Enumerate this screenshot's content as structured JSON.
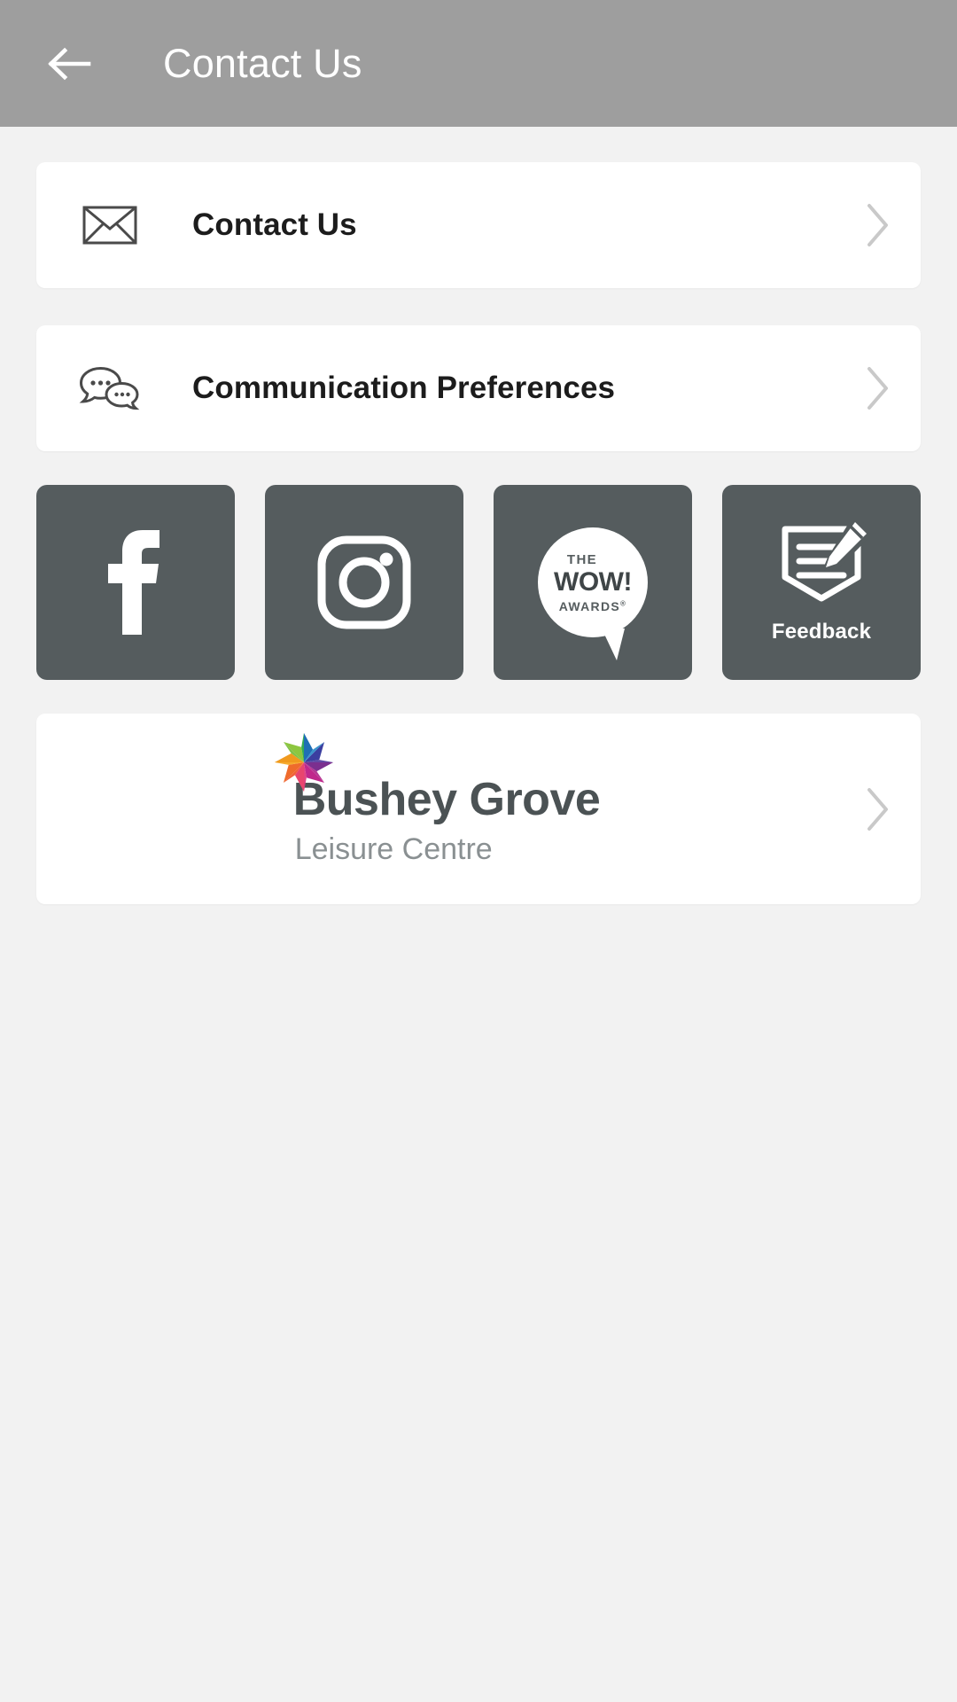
{
  "appbar": {
    "back_icon": "back-arrow-icon",
    "title": "Contact Us",
    "background_color": "#9e9e9e",
    "title_color": "#ffffff"
  },
  "colors": {
    "page_background": "#f2f2f2",
    "card_background": "#ffffff",
    "tile_background": "#555c5e",
    "chevron": "#c9c9c9",
    "primary_text": "#1c1c1c",
    "logo_name": "#4b5254",
    "logo_sub": "#8a9092"
  },
  "rows": [
    {
      "icon": "envelope-icon",
      "label": "Contact Us",
      "chevron": "chevron-right-icon"
    },
    {
      "icon": "chat-bubbles-icon",
      "label": "Communication Preferences",
      "chevron": "chevron-right-icon"
    }
  ],
  "tiles": [
    {
      "icon": "facebook-icon",
      "label": ""
    },
    {
      "icon": "instagram-icon",
      "label": ""
    },
    {
      "icon": "wow-awards-icon",
      "label": "",
      "wow_the": "THE",
      "wow_main": "WOW!",
      "wow_awards": "AWARDS",
      "wow_registered": "®"
    },
    {
      "icon": "feedback-form-pencil-icon",
      "label": "Feedback"
    }
  ],
  "logo_card": {
    "star_icon": "pinwheel-star-icon",
    "name": "Bushey Grove",
    "subtitle": "Leisure Centre",
    "chevron": "chevron-right-icon",
    "star_colors": [
      "#3aa655",
      "#1f9e8f",
      "#1f6fb5",
      "#3b3fa0",
      "#7b2f8f",
      "#c0288c",
      "#e8456e",
      "#ef6b2b",
      "#f09a1e",
      "#8dc63f"
    ]
  }
}
